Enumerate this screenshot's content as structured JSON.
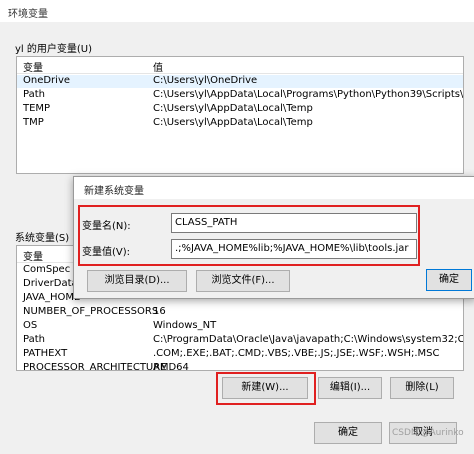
{
  "window": {
    "title": "环境变量",
    "user_group_label": "yl 的用户变量(U)",
    "system_group_label": "系统变量(S)",
    "ok_button": "确定",
    "cancel_button": "取消"
  },
  "user_vars": {
    "headers": [
      "变量",
      "值"
    ],
    "rows": [
      {
        "name": "OneDrive",
        "value": "C:\\Users\\yl\\OneDrive"
      },
      {
        "name": "Path",
        "value": "C:\\Users\\yl\\AppData\\Local\\Programs\\Python\\Python39\\Scripts\\;C:..."
      },
      {
        "name": "TEMP",
        "value": "C:\\Users\\yl\\AppData\\Local\\Temp"
      },
      {
        "name": "TMP",
        "value": "C:\\Users\\yl\\AppData\\Local\\Temp"
      }
    ]
  },
  "system_vars": {
    "headers": [
      "变量",
      "值"
    ],
    "rows": [
      {
        "name": "ComSpec",
        "value": ""
      },
      {
        "name": "DriverData",
        "value": ""
      },
      {
        "name": "JAVA_HOME",
        "value": ""
      },
      {
        "name": "NUMBER_OF_PROCESSORS",
        "value": "16"
      },
      {
        "name": "OS",
        "value": "Windows_NT"
      },
      {
        "name": "Path",
        "value": "C:\\ProgramData\\Oracle\\Java\\javapath;C:\\Windows\\system32;C:\\Wi..."
      },
      {
        "name": "PATHEXT",
        "value": ".COM;.EXE;.BAT;.CMD;.VBS;.VBE;.JS;.JSE;.WSF;.WSH;.MSC"
      },
      {
        "name": "PROCESSOR_ARCHITECTURE",
        "value": "AMD64"
      }
    ],
    "new_button": "新建(W)...",
    "edit_button": "编辑(I)...",
    "delete_button": "删除(L)"
  },
  "dialog": {
    "title": "新建系统变量",
    "name_label": "变量名(N):",
    "name_value": "CLASS_PATH",
    "value_label": "变量值(V):",
    "value_value": ".;%JAVA_HOME%lib;%JAVA_HOME%\\lib\\tools.jar",
    "browse_dir_button": "浏览目录(D)...",
    "browse_file_button": "浏览文件(F)...",
    "ok_button": "确定"
  },
  "watermark": "CSDN @Aurinko"
}
